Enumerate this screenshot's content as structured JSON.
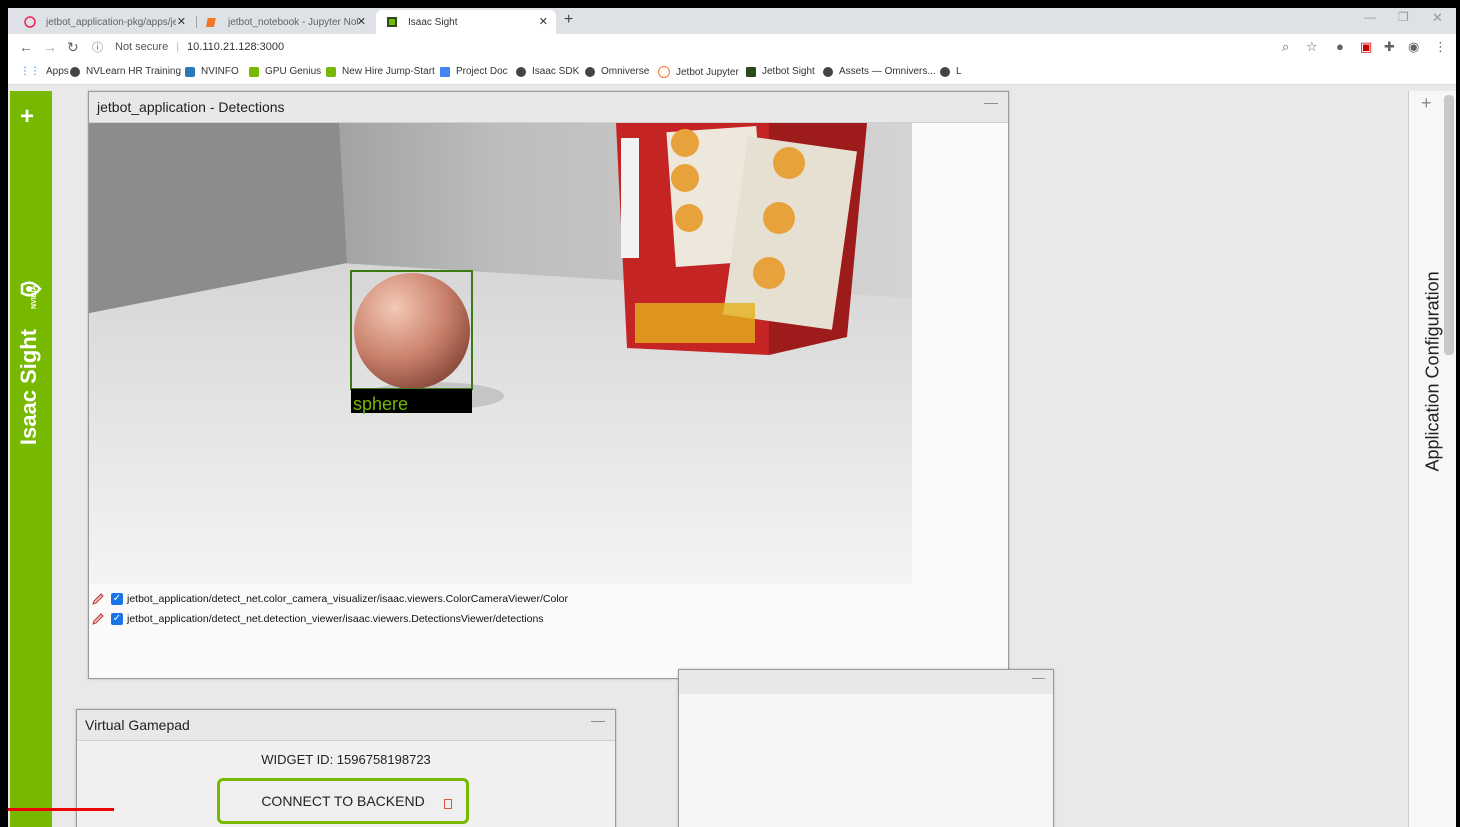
{
  "tabs": [
    {
      "title": "jetbot_application-pkg/apps/jetb",
      "active": false
    },
    {
      "title": "jetbot_notebook - Jupyter Noteb",
      "active": false
    },
    {
      "title": "Isaac Sight",
      "active": true
    }
  ],
  "address": {
    "security": "Not secure",
    "url": "10.110.21.128:3000"
  },
  "bookmarks": [
    "Apps",
    "NVLearn HR Training",
    "NVINFO",
    "GPU Genius",
    "New Hire Jump-Start",
    "Project Doc",
    "Isaac SDK",
    "Omniverse",
    "Jetbot Jupyter",
    "Jetbot Sight",
    "Assets — Omnivers...",
    "L"
  ],
  "sidebar": {
    "brand": "Isaac Sight",
    "logo_text": "NVIDIA"
  },
  "detections_widget": {
    "title": "jetbot_application - Detections",
    "detection_label": "sphere",
    "channels": [
      {
        "label": "jetbot_application/detect_net.color_camera_visualizer/isaac.viewers.ColorCameraViewer/Color",
        "checked": true
      },
      {
        "label": "jetbot_application/detect_net.detection_viewer/isaac.viewers.DetectionsViewer/detections",
        "checked": true
      }
    ]
  },
  "gamepad_widget": {
    "title": "Virtual Gamepad",
    "widget_id": "WIDGET ID: 1596758198723",
    "connect_label": "CONNECT TO BACKEND"
  },
  "right_panel": {
    "title": "Application Configuration"
  },
  "colors": {
    "nvidia_green": "#76b900",
    "checkbox_blue": "#1a73e8"
  }
}
